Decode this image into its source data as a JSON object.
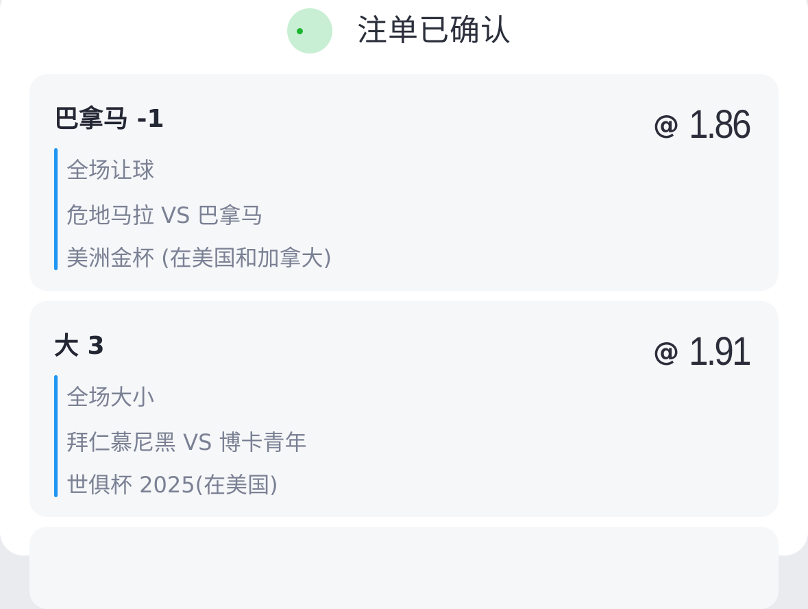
{
  "header": {
    "title": "注单已确认",
    "status_color": "#1bb52f"
  },
  "bets": [
    {
      "selection": "巴拿马  -1",
      "odds_prefix": "@",
      "odds_value": "1.86",
      "market": "全场让球",
      "match": "危地马拉 VS 巴拿马",
      "league": "美洲金杯 (在美国和加拿大)"
    },
    {
      "selection": "大 3",
      "odds_prefix": "@",
      "odds_value": "1.91",
      "market": "全场大小",
      "match": "拜仁慕尼黑 VS 博卡青年",
      "league": "世俱杯 2025(在美国)"
    }
  ],
  "colors": {
    "accent": "#2196f3",
    "card_background": "#f6f7f9",
    "success": "#1bb52f"
  }
}
